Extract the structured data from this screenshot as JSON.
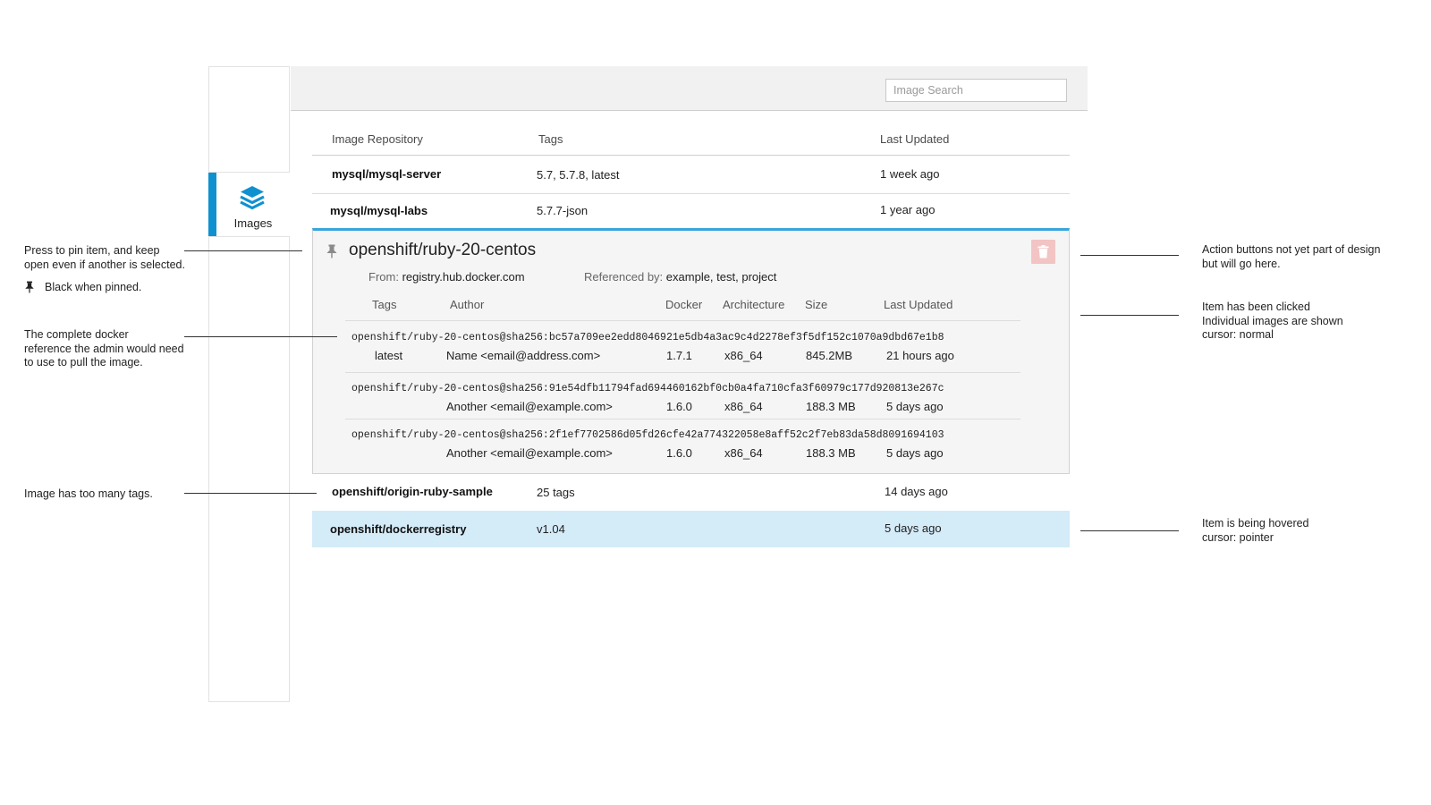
{
  "sidebar": {
    "items": [
      {
        "label": "Images",
        "icon": "layers-icon",
        "active": true
      }
    ]
  },
  "header": {
    "search": {
      "placeholder": "Image Search",
      "value": ""
    }
  },
  "table": {
    "headers": {
      "repository": "Image Repository",
      "tags": "Tags",
      "updated": "Last Updated"
    },
    "rows": [
      {
        "name": "mysql/mysql-server",
        "tags": "5.7, 5.7.8, latest",
        "updated": "1 week ago"
      },
      {
        "name": "mysql/mysql-labs",
        "tags": "5.7.7-json",
        "updated": "1 year ago"
      },
      {
        "name": "openshift/origin-ruby-sample",
        "tags": "25 tags",
        "updated": "14 days ago"
      },
      {
        "name": "openshift/dockerregistry",
        "tags": "v1.04",
        "updated": "5 days ago"
      }
    ]
  },
  "expanded": {
    "title": "openshift/ruby-20-centos",
    "from_label": "From:",
    "from_value": "registry.hub.docker.com",
    "ref_label": "Referenced by:",
    "ref_value": "example, test, project",
    "subheaders": {
      "tags": "Tags",
      "author": "Author",
      "docker": "Docker",
      "arch": "Architecture",
      "size": "Size",
      "updated": "Last Updated"
    },
    "images": [
      {
        "ref": "openshift/ruby-20-centos@sha256:bc57a709ee2edd8046921e5db4a3ac9c4d2278ef3f5df152c1070a9dbd67e1b8",
        "tag": "latest",
        "author": "Name <email@address.com>",
        "docker": "1.7.1",
        "arch": "x86_64",
        "size": "845.2MB",
        "updated": "21 hours ago"
      },
      {
        "ref": "openshift/ruby-20-centos@sha256:91e54dfb11794fad694460162bf0cb0a4fa710cfa3f60979c177d920813e267c",
        "tag": "",
        "author": "Another <email@example.com>",
        "docker": "1.6.0",
        "arch": "x86_64",
        "size": "188.3 MB",
        "updated": "5 days ago"
      },
      {
        "ref": "openshift/ruby-20-centos@sha256:2f1ef7702586d05fd26cfe42a774322058e8aff52c2f7eb83da58d8091694103",
        "tag": "",
        "author": "Another <email@example.com>",
        "docker": "1.6.0",
        "arch": "x86_64",
        "size": "188.3 MB",
        "updated": "5 days ago"
      }
    ]
  },
  "annotations": {
    "pin": "Press to pin item, and keep\nopen even if another is selected.",
    "pinned": "Black when pinned.",
    "docker_ref": "The complete docker\nreference the admin would need\nto use to pull the image.",
    "too_many_tags": "Image has too many tags.",
    "actions": "Action buttons not yet part of design\nbut will go here.",
    "clicked": "Item has been clicked\nIndividual images are shown\ncursor: normal",
    "hovered": "Item is being hovered\ncursor: pointer"
  },
  "colors": {
    "accent": "#0f91d0",
    "expanded_border": "#39a5dc",
    "hover_bg": "#d4ebf8",
    "delete_btn": "#f2c4c4"
  }
}
